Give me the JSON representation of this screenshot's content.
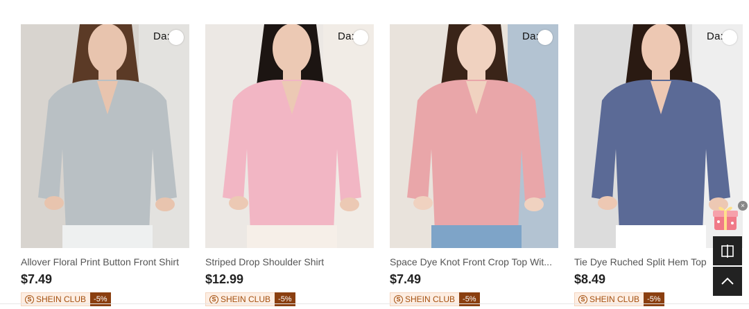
{
  "products": [
    {
      "tag": "Da:",
      "title": "Allover Floral Print Button Front Shirt",
      "price": "$7.49",
      "club_label": "SHEIN CLUB",
      "discount": "-5%",
      "colors": {
        "bg": "#d8d4cf",
        "garment": "#b9c0c4",
        "skin": "#e8c4ae",
        "hair": "#5b3a26",
        "accent": "#eef0f0"
      }
    },
    {
      "tag": "Da:",
      "title": "Striped Drop Shoulder Shirt",
      "price": "$12.99",
      "club_label": "SHEIN CLUB",
      "discount": "-5%",
      "colors": {
        "bg": "#ece8e4",
        "garment": "#f2b6c4",
        "skin": "#ecc9b4",
        "hair": "#1c1512",
        "accent": "#f6efe8"
      }
    },
    {
      "tag": "Da:",
      "title": "Space Dye Knot Front Crop Top Wit...",
      "price": "$7.49",
      "club_label": "SHEIN CLUB",
      "discount": "-5%",
      "colors": {
        "bg": "#e9e3dc",
        "garment": "#e9a6a9",
        "skin": "#f0d2c0",
        "hair": "#3a2418",
        "accent": "#7ea4c8"
      }
    },
    {
      "tag": "Da:",
      "title": "Tie Dye Ruched Split Hem Top",
      "price": "$8.49",
      "club_label": "SHEIN CLUB",
      "discount": "-5%",
      "colors": {
        "bg": "#dcdcdc",
        "garment": "#5b6a96",
        "skin": "#edc8b3",
        "hair": "#2a1a12",
        "accent": "#ffffff"
      }
    }
  ],
  "side": {
    "compare_icon": "split-screen-icon",
    "top_icon": "chevron-up-icon",
    "gift_icon": "gift-box-icon",
    "close_symbol": "×"
  }
}
